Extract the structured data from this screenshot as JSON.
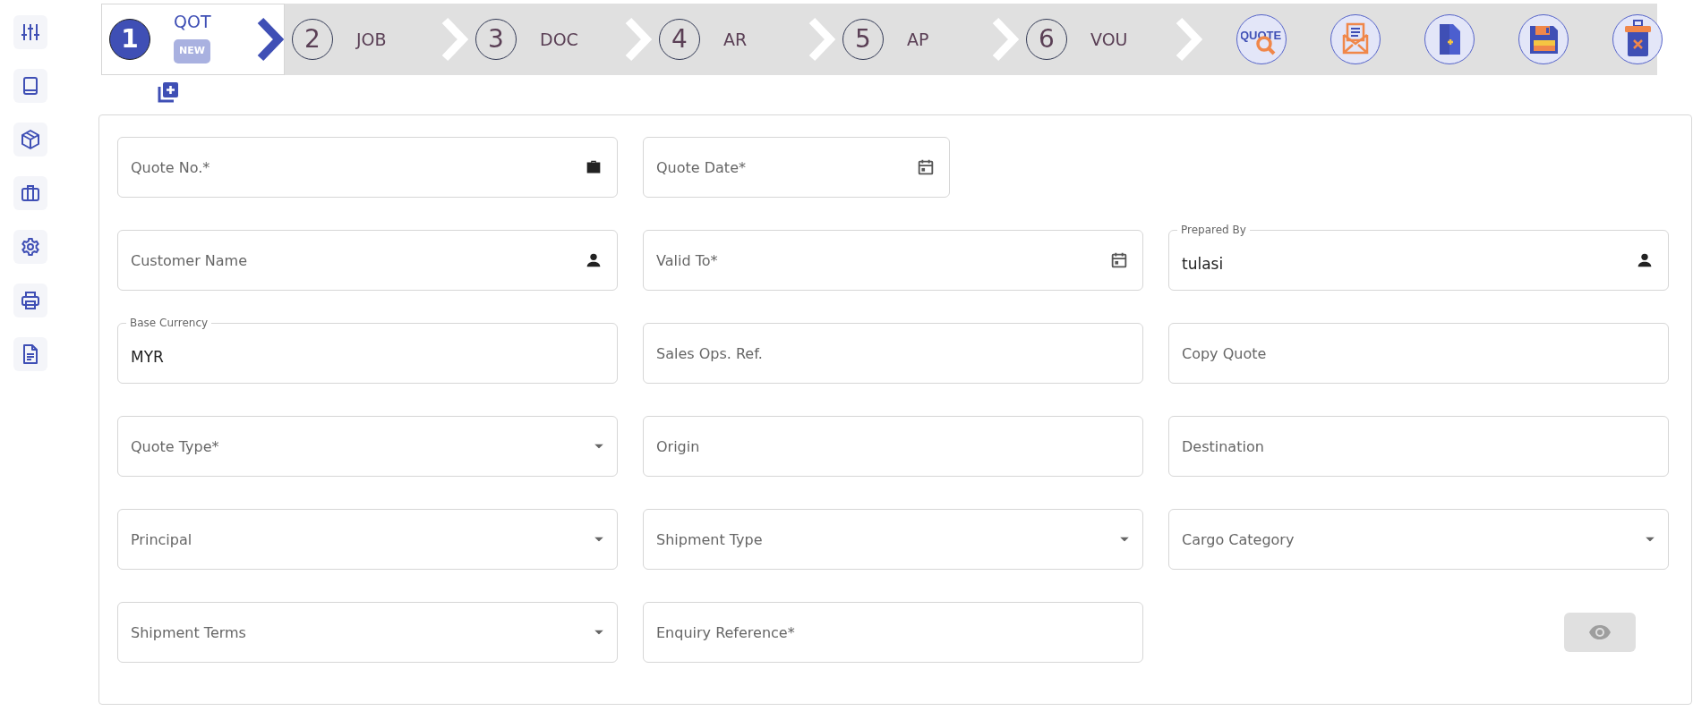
{
  "sidebar": {
    "items": [
      {
        "kind": "sliders"
      },
      {
        "kind": "book"
      },
      {
        "kind": "cube"
      },
      {
        "kind": "briefcase"
      },
      {
        "kind": "gear"
      },
      {
        "kind": "printer"
      },
      {
        "kind": "document"
      }
    ]
  },
  "steps": [
    {
      "number": "1",
      "label": "QOT",
      "badge": "NEW",
      "selected": true
    },
    {
      "number": "2",
      "label": "JOB",
      "selected": false
    },
    {
      "number": "3",
      "label": "DOC",
      "selected": false
    },
    {
      "number": "4",
      "label": "AR",
      "selected": false
    },
    {
      "number": "5",
      "label": "AP",
      "selected": false
    },
    {
      "number": "6",
      "label": "VOU",
      "selected": false
    }
  ],
  "actions": [
    {
      "kind": "quote-search",
      "text": "QUOTE"
    },
    {
      "kind": "envelope"
    },
    {
      "kind": "new-document"
    },
    {
      "kind": "save"
    },
    {
      "kind": "delete"
    }
  ],
  "form": {
    "rows": [
      [
        {
          "kind": "number",
          "placeholder": "Quote No.*"
        },
        {
          "kind": "date",
          "placeholder": "Quote Date*"
        }
      ],
      [
        {
          "kind": "user",
          "placeholder": "Customer Name"
        },
        {
          "kind": "date",
          "placeholder": "Valid To*"
        },
        {
          "kind": "user",
          "label": "Prepared By",
          "value": "tulasi"
        }
      ],
      [
        {
          "kind": "text",
          "label": "Base Currency",
          "value": "MYR"
        },
        {
          "kind": "text",
          "placeholder": "Sales Ops. Ref."
        },
        {
          "kind": "text",
          "placeholder": "Copy Quote"
        }
      ],
      [
        {
          "kind": "select",
          "placeholder": "Quote Type*"
        },
        {
          "kind": "text",
          "placeholder": "Origin"
        },
        {
          "kind": "text",
          "placeholder": "Destination"
        }
      ],
      [
        {
          "kind": "select",
          "placeholder": "Principal"
        },
        {
          "kind": "select",
          "placeholder": "Shipment Type"
        },
        {
          "kind": "select",
          "placeholder": "Cargo Category"
        }
      ],
      [
        {
          "kind": "select",
          "placeholder": "Shipment Terms"
        },
        {
          "kind": "text",
          "placeholder": "Enquiry Reference*"
        }
      ]
    ],
    "preview_button": {
      "disabled": true
    }
  }
}
